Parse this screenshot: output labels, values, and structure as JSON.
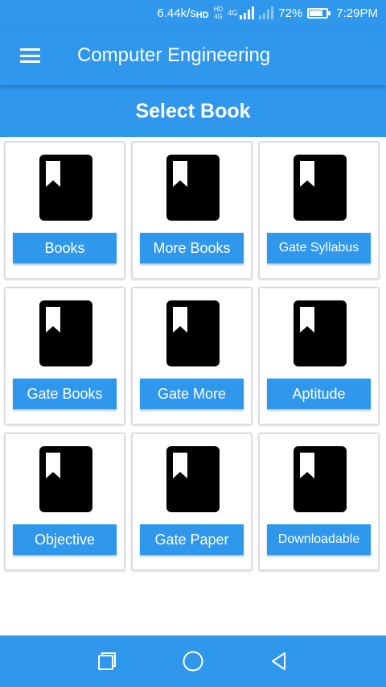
{
  "status_bar": {
    "speed": "6.44k/s",
    "hd_label": "HD",
    "network_label": "4G",
    "volte_top": "HD",
    "volte_bottom": "4G",
    "battery_percent": "72%",
    "battery_level": 0.72,
    "time": "7:29PM"
  },
  "app_bar": {
    "title": "Computer Engineering",
    "menu_icon": "hamburger-menu-icon"
  },
  "section": {
    "title": "Select Book"
  },
  "cards": [
    {
      "label": "Books",
      "icon": "book-bookmark-icon"
    },
    {
      "label": "More Books",
      "icon": "book-bookmark-icon"
    },
    {
      "label": "Gate Syllabus",
      "icon": "book-bookmark-icon"
    },
    {
      "label": "Gate Books",
      "icon": "book-bookmark-icon"
    },
    {
      "label": "Gate More",
      "icon": "book-bookmark-icon"
    },
    {
      "label": "Aptitude",
      "icon": "book-bookmark-icon"
    },
    {
      "label": "Objective",
      "icon": "book-bookmark-icon"
    },
    {
      "label": "Gate Paper",
      "icon": "book-bookmark-icon"
    },
    {
      "label": "Downloadable",
      "icon": "book-bookmark-icon"
    }
  ],
  "nav_bar": {
    "recents_icon": "recents-square-icon",
    "home_icon": "home-circle-icon",
    "back_icon": "back-triangle-icon"
  },
  "colors": {
    "primary": "#2f97ec",
    "card_border": "#dcdcdc",
    "icon": "#000000"
  }
}
